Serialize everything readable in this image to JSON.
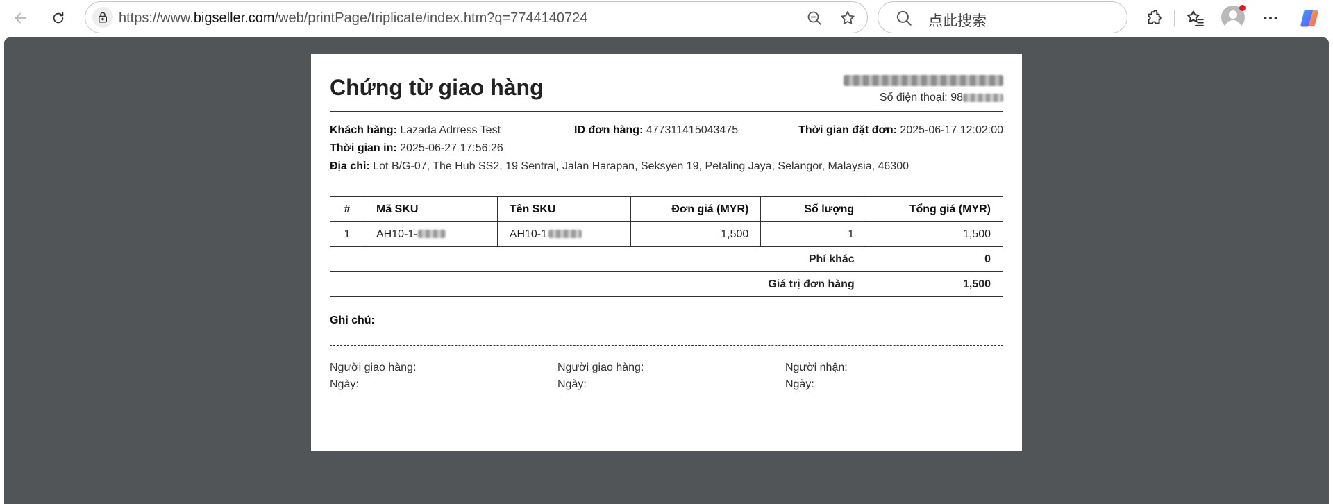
{
  "browser": {
    "url_prefix": "https://www.",
    "url_domain": "bigseller.com",
    "url_path": "/web/printPage/triplicate/index.htm?q=7744140724",
    "search_placeholder": "点此搜索",
    "icons": {
      "back": "arrow-left-icon",
      "reload": "reload-icon",
      "lock": "lock-icon",
      "zoom": "zoom-out-icon",
      "favorite": "star-icon",
      "search": "search-icon",
      "extensions": "puzzle-icon",
      "favorites_list": "favorites-list-icon",
      "profile": "avatar",
      "more": "more-icon",
      "copilot": "copilot-icon"
    }
  },
  "document": {
    "title": "Chứng từ giao hàng",
    "phone_label": "Số điện thoại:",
    "phone_visible": "98",
    "customer_label": "Khách hàng:",
    "customer_value": "Lazada Adrress Test",
    "order_id_label": "ID đơn hàng:",
    "order_id_value": "477311415043475",
    "order_time_label": "Thời gian đặt đơn:",
    "order_time_value": "2025-06-17 12:02:00",
    "print_time_label": "Thời gian in:",
    "print_time_value": "2025-06-27 17:56:26",
    "address_label": "Địa chỉ:",
    "address_value": "Lot B/G-07, The Hub SS2, 19 Sentral, Jalan Harapan, Seksyen 19, Petaling Jaya, Selangor, Malaysia, 46300",
    "table": {
      "headers": [
        "#",
        "Mã SKU",
        "Tên SKU",
        "Đơn giá (MYR)",
        "Số lượng",
        "Tổng giá (MYR)"
      ],
      "rows": [
        {
          "index": "1",
          "sku_code": "AH10-1-",
          "sku_name": "AH10-1",
          "unit_price": "1,500",
          "quantity": "1",
          "total": "1,500"
        }
      ],
      "other_fee_label": "Phí khác",
      "other_fee_value": "0",
      "order_value_label": "Giá trị đơn hàng",
      "order_value_value": "1,500"
    },
    "note_label": "Ghi chú:",
    "signatures": [
      {
        "role": "Người giao hàng:",
        "date": "Ngày:"
      },
      {
        "role": "Người giao hàng:",
        "date": "Ngày:"
      },
      {
        "role": "Người nhận:",
        "date": "Ngày:"
      }
    ]
  },
  "colors": {
    "viewport_bg": "#515558",
    "paper_bg": "#ffffff",
    "text": "#222222",
    "notification_dot": "#e21b1b"
  }
}
